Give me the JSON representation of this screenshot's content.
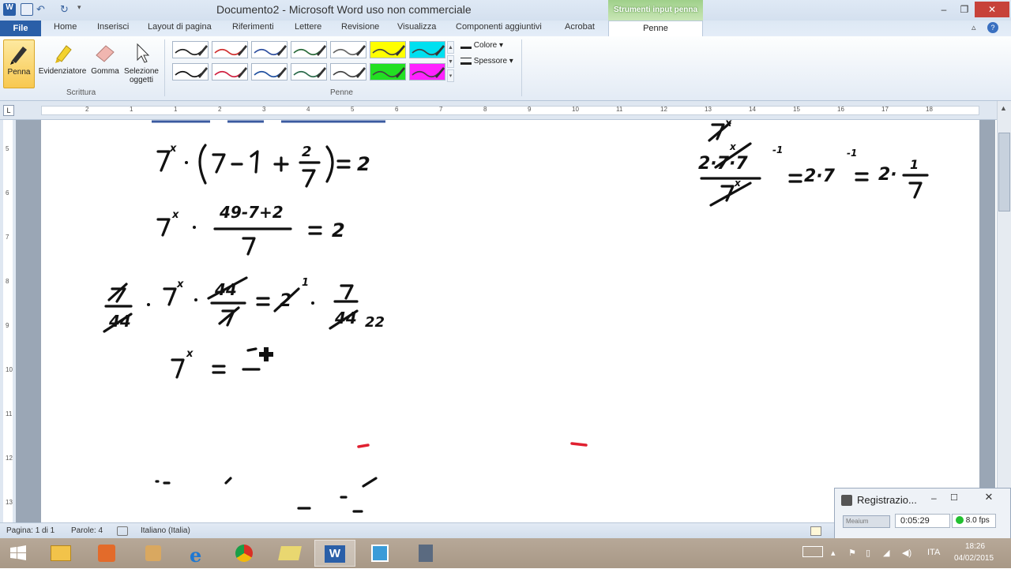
{
  "titlebar": {
    "title": "Documento2 - Microsoft Word uso non commerciale",
    "contextual_tab_group": "Strumenti input penna",
    "minimize": "–",
    "maximize": "❐",
    "close": "✕"
  },
  "tabs": [
    "File",
    "Home",
    "Inserisci",
    "Layout di pagina",
    "Riferimenti",
    "Lettere",
    "Revisione",
    "Visualizza",
    "Componenti aggiuntivi",
    "Acrobat",
    "Penne"
  ],
  "ribbon": {
    "scrittura": {
      "label": "Scrittura",
      "penna": "Penna",
      "evidenziatore": "Evidenziatore",
      "gomma": "Gomma",
      "selezione_1": "Selezione",
      "selezione_2": "oggetti"
    },
    "penne": {
      "label": "Penne",
      "swatches": [
        {
          "color": "#222222",
          "kind": "pen"
        },
        {
          "color": "#d03030",
          "kind": "pen"
        },
        {
          "color": "#3050a0",
          "kind": "pen"
        },
        {
          "color": "#2a6a3a",
          "kind": "pen"
        },
        {
          "color": "#666666",
          "kind": "pen"
        },
        {
          "color": "#ffff00",
          "kind": "highlighter"
        },
        {
          "color": "#00e0f0",
          "kind": "highlighter"
        },
        {
          "color": "#111111",
          "kind": "pen"
        },
        {
          "color": "#d02040",
          "kind": "pen"
        },
        {
          "color": "#2050a0",
          "kind": "pen"
        },
        {
          "color": "#2a6a4a",
          "kind": "pen"
        },
        {
          "color": "#444444",
          "kind": "pen"
        },
        {
          "color": "#22e022",
          "kind": "highlighter"
        },
        {
          "color": "#ff22ff",
          "kind": "highlighter"
        }
      ],
      "colore": "Colore",
      "spessore": "Spessore"
    }
  },
  "ruler": {
    "numbers": [
      "2",
      "1",
      "1",
      "2",
      "3",
      "4",
      "5",
      "6",
      "7",
      "8",
      "9",
      "10",
      "11",
      "12",
      "13",
      "14",
      "15",
      "16",
      "17",
      "18"
    ],
    "vnumbers": [
      "5",
      "6",
      "7",
      "8",
      "9",
      "10",
      "11",
      "12",
      "13"
    ]
  },
  "document": {
    "line1": "7ˣ·(7 − 1 + 2/7) = 2",
    "line2": "7ˣ · (49−7+2)/7 = 2",
    "line4": "7ˣ = ",
    "side": "= 2·7⁻¹ = 2·1/7"
  },
  "status": {
    "page": "Pagina: 1 di 1",
    "words": "Parole: 4",
    "language": "Italiano (Italia)"
  },
  "recorder": {
    "title": "Registrazio...",
    "time": "0:05:29",
    "fps": "8.0 fps",
    "combo": "Meaium"
  },
  "taskbar": {
    "lang": "ITA",
    "time": "18:26",
    "date": "04/02/2015"
  }
}
